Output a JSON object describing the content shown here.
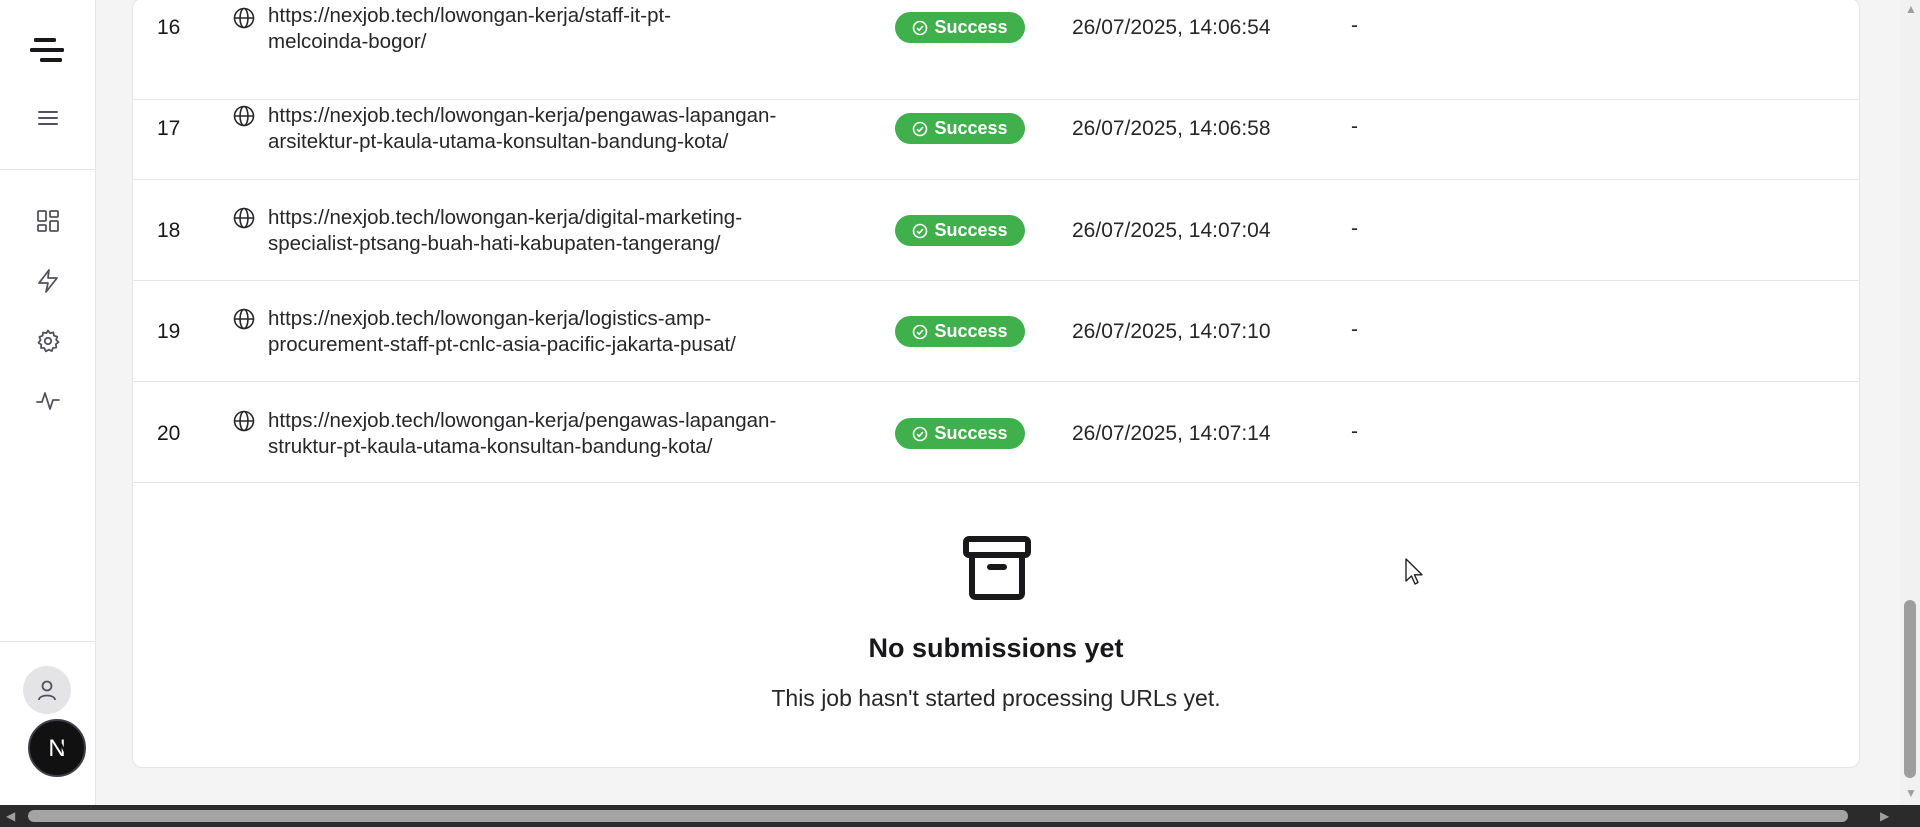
{
  "sidebar": {
    "icons": [
      "logo-icon",
      "menu-icon",
      "dashboard-icon",
      "lightning-icon",
      "settings-icon",
      "activity-icon"
    ],
    "user_avatar": "user-icon",
    "profile_initial": "N"
  },
  "rows": [
    {
      "num": "16",
      "url_line1": "https://nexjob.tech/lowongan-kerja/staff-it-pt-",
      "url_line2": "melcoinda-bogor/",
      "status": "Success",
      "date": "26/07/2025, 14:06:54",
      "extra": "-"
    },
    {
      "num": "17",
      "url_line1": "https://nexjob.tech/lowongan-kerja/pengawas-lapangan-",
      "url_line2": "arsitektur-pt-kaula-utama-konsultan-bandung-kota/",
      "status": "Success",
      "date": "26/07/2025, 14:06:58",
      "extra": "-"
    },
    {
      "num": "18",
      "url_line1": "https://nexjob.tech/lowongan-kerja/digital-marketing-",
      "url_line2": "specialist-ptsang-buah-hati-kabupaten-tangerang/",
      "status": "Success",
      "date": "26/07/2025, 14:07:04",
      "extra": "-"
    },
    {
      "num": "19",
      "url_line1": "https://nexjob.tech/lowongan-kerja/logistics-amp-",
      "url_line2": "procurement-staff-pt-cnlc-asia-pacific-jakarta-pusat/",
      "status": "Success",
      "date": "26/07/2025, 14:07:10",
      "extra": "-"
    },
    {
      "num": "20",
      "url_line1": "https://nexjob.tech/lowongan-kerja/pengawas-lapangan-",
      "url_line2": "struktur-pt-kaula-utama-konsultan-bandung-kota/",
      "status": "Success",
      "date": "26/07/2025, 14:07:14",
      "extra": "-"
    }
  ],
  "empty_state": {
    "icon": "archive-icon",
    "title": "No submissions yet",
    "subtitle": "This job hasn't started processing URLs yet."
  },
  "colors": {
    "success": "#3fb04c",
    "border": "#e4e4e7",
    "background": "#f4f4f5"
  }
}
